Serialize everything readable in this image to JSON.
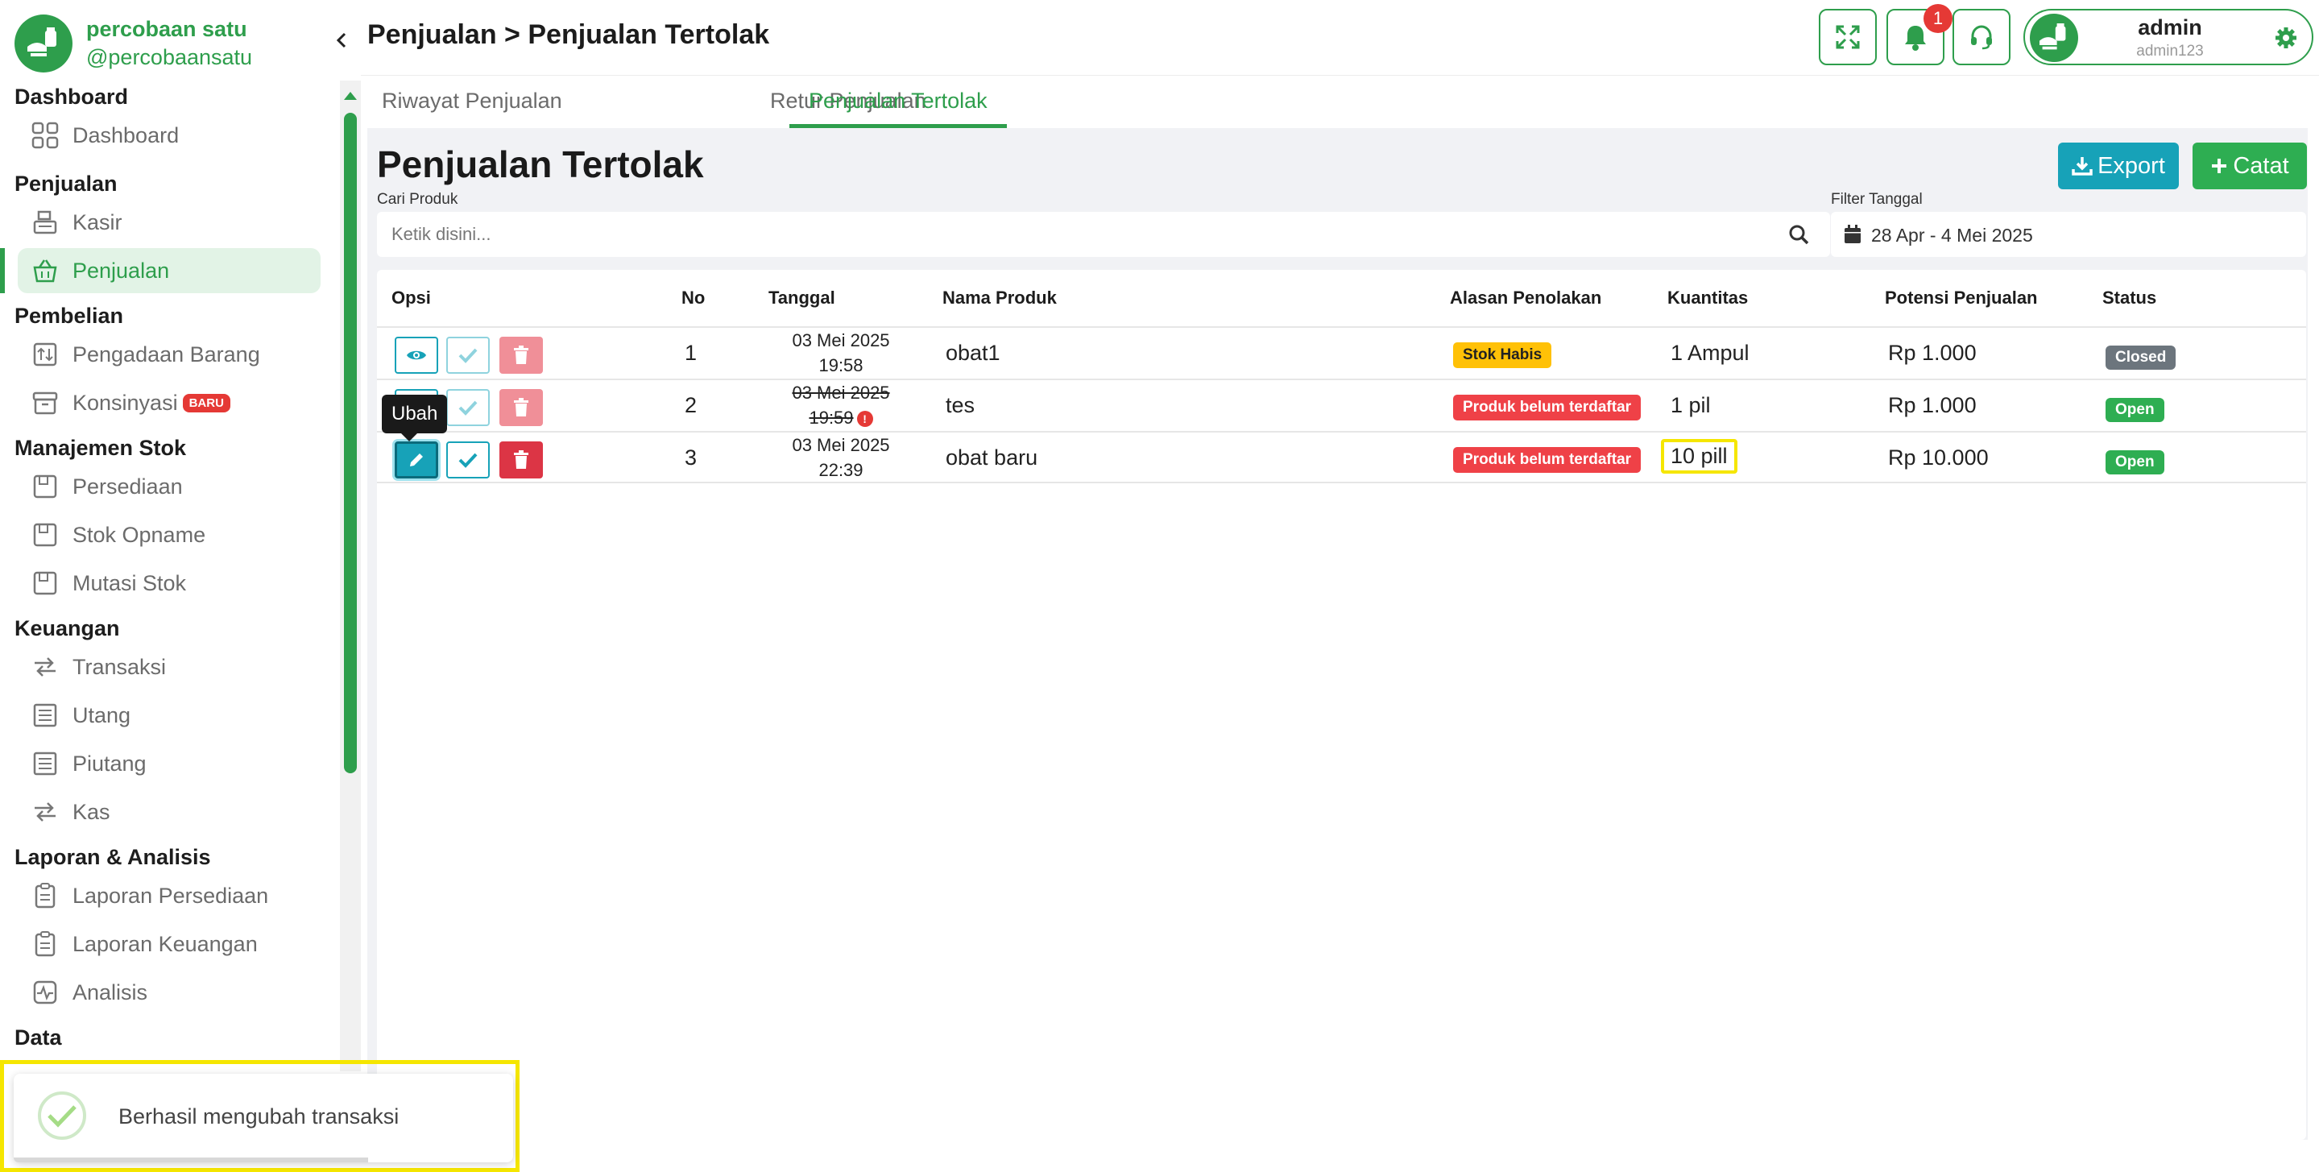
{
  "brand": {
    "name": "percobaan satu",
    "handle": "@percobaansatu"
  },
  "sidebar": {
    "sections": [
      {
        "title": "Dashboard",
        "items": [
          {
            "label": "Dashboard",
            "icon": "grid-icon"
          }
        ]
      },
      {
        "title": "Penjualan",
        "items": [
          {
            "label": "Kasir",
            "icon": "cash-register-icon"
          },
          {
            "label": "Penjualan",
            "icon": "basket-icon",
            "active": true
          }
        ]
      },
      {
        "title": "Pembelian",
        "items": [
          {
            "label": "Pengadaan Barang",
            "icon": "procurement-icon"
          },
          {
            "label": "Konsinyasi",
            "icon": "archive-box-icon",
            "badge": "BARU"
          }
        ]
      },
      {
        "title": "Manajemen Stok",
        "items": [
          {
            "label": "Persediaan",
            "icon": "inventory-icon"
          },
          {
            "label": "Stok Opname",
            "icon": "stock-opname-icon"
          },
          {
            "label": "Mutasi Stok",
            "icon": "stock-mutation-icon"
          }
        ]
      },
      {
        "title": "Keuangan",
        "items": [
          {
            "label": "Transaksi",
            "icon": "exchange-icon"
          },
          {
            "label": "Utang",
            "icon": "ledger-icon"
          },
          {
            "label": "Piutang",
            "icon": "ledger-icon"
          },
          {
            "label": "Kas",
            "icon": "exchange-icon"
          }
        ]
      },
      {
        "title": "Laporan & Analisis",
        "items": [
          {
            "label": "Laporan Persediaan",
            "icon": "clipboard-icon"
          },
          {
            "label": "Laporan Keuangan",
            "icon": "clipboard-icon"
          },
          {
            "label": "Analisis",
            "icon": "activity-icon"
          }
        ]
      },
      {
        "title": "Data",
        "items": []
      }
    ]
  },
  "header": {
    "breadcrumb": "Penjualan > Penjualan Tertolak",
    "notification_count": "1",
    "user": {
      "name": "admin",
      "id": "admin123"
    }
  },
  "tabs": [
    {
      "label": "Riwayat Penjualan"
    },
    {
      "label": "Retur Penjualan"
    },
    {
      "label": "Penjualan Tertolak",
      "active": true
    }
  ],
  "main": {
    "title": "Penjualan Tertolak",
    "export_label": "Export",
    "catat_label": "Catat",
    "search": {
      "label": "Cari Produk",
      "placeholder": "Ketik disini..."
    },
    "date_filter": {
      "label": "Filter Tanggal",
      "value": "28 Apr - 4 Mei 2025"
    }
  },
  "table": {
    "headers": [
      "Opsi",
      "No",
      "Tanggal",
      "Nama Produk",
      "Alasan Penolakan",
      "Kuantitas",
      "Potensi Penjualan",
      "Status"
    ],
    "rows": [
      {
        "no": "1",
        "date": "03 Mei 2025",
        "time": "19:58",
        "product": "obat1",
        "reason": "Stok Habis",
        "reason_type": "warning",
        "qty": "1 Ampul",
        "potential": "Rp 1.000",
        "status": "Closed"
      },
      {
        "no": "2",
        "date": "03 Mei 2025",
        "time": "19:59",
        "product": "tes",
        "reason": "Produk belum terdaftar",
        "reason_type": "danger",
        "qty": "1 pil",
        "potential": "Rp 1.000",
        "status": "Open"
      },
      {
        "no": "3",
        "date": "03 Mei 2025",
        "time": "22:39",
        "product": "obat baru",
        "reason": "Produk belum terdaftar",
        "reason_type": "danger",
        "qty": "10 pill",
        "potential": "Rp 10.000",
        "status": "Open"
      }
    ]
  },
  "tooltip": "Ubah",
  "toast": {
    "message": "Berhasil mengubah transaksi"
  },
  "colors": {
    "brand": "#2e9e4c",
    "info": "#17a2b8",
    "danger": "#dc3545",
    "warning": "#ffc107",
    "muted": "#6c757d"
  }
}
